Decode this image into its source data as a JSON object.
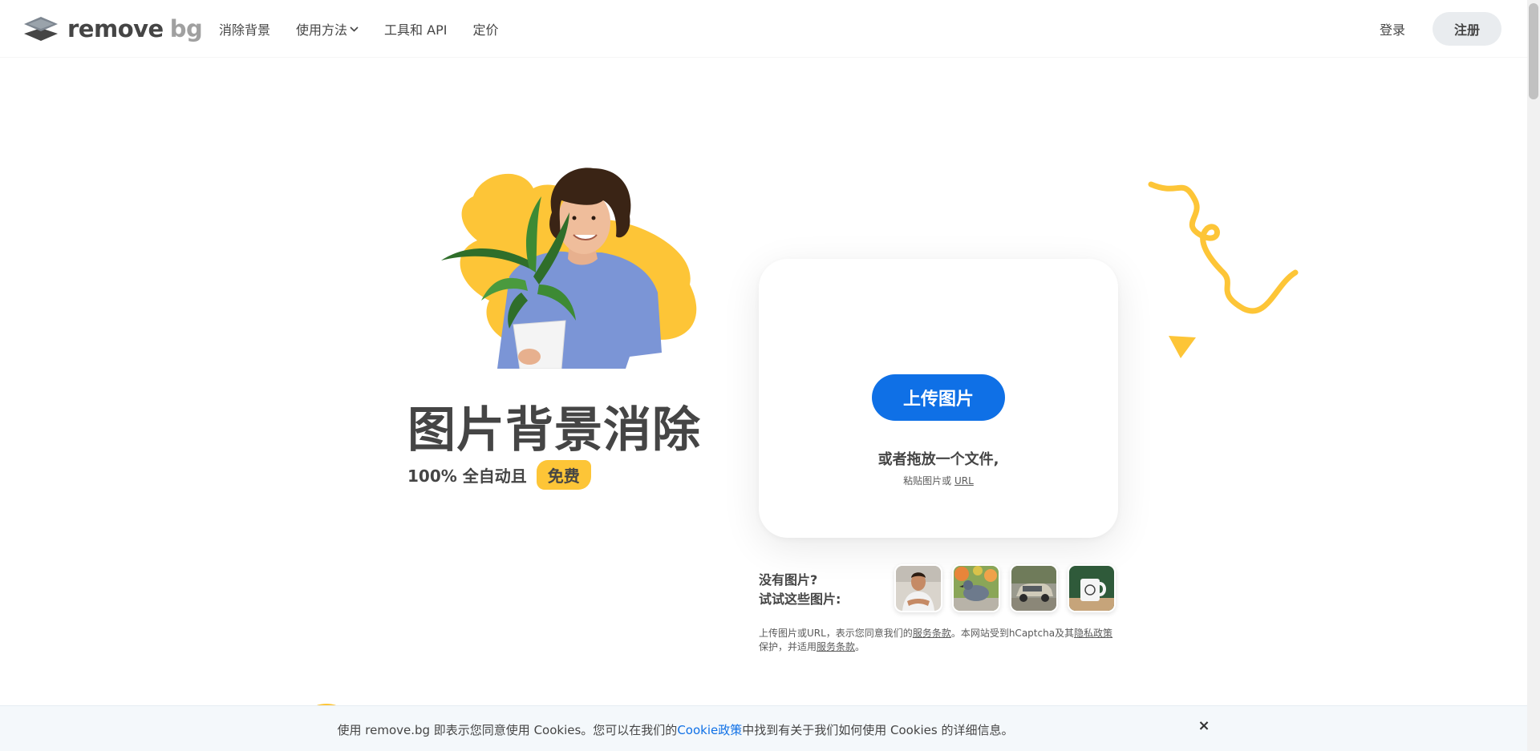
{
  "header": {
    "logo_word1": "remove",
    "logo_word2": "bg",
    "nav": [
      {
        "label": "消除背景"
      },
      {
        "label": "使用方法"
      },
      {
        "label": "工具和 API"
      },
      {
        "label": "定价"
      }
    ],
    "login_label": "登录",
    "signup_label": "注册"
  },
  "hero": {
    "title": "图片背景消除",
    "subtitle": "100% 全自动且",
    "badge": "免费"
  },
  "upload": {
    "button_label": "上传图片",
    "drop_text": "或者拖放一个文件,",
    "paste_prefix": "粘贴图片或",
    "paste_url": "URL"
  },
  "samples": {
    "line1": "没有图片?",
    "line2": "试试这些图片:",
    "items": [
      "person",
      "bird",
      "car",
      "mug"
    ]
  },
  "terms": {
    "part1": "上传图片或URL，表示您同意我们的",
    "link1": "服务条款",
    "part2": "。本网站受到hCaptcha及其",
    "link2": "隐私政策",
    "part3": "保护，并适用",
    "link3": "服务条款",
    "part4": "。"
  },
  "cookie": {
    "before": "使用 remove.bg 即表示您同意使用 Cookies。您可以在我们的",
    "link": "Cookie政策",
    "after": "中找到有关于我们如何使用 Cookies 的详细信息。",
    "close": "×"
  },
  "colors": {
    "accent_blue": "#0f70e6",
    "yellow": "#fdc537",
    "text": "#454545"
  }
}
